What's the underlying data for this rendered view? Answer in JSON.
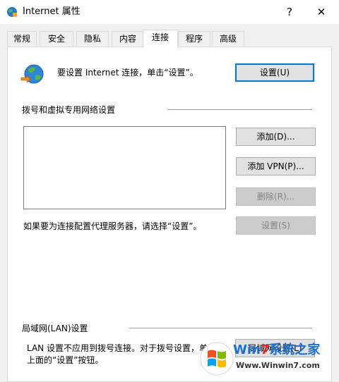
{
  "window": {
    "title": "Internet 属性",
    "help_label": "?",
    "close_label": "✕"
  },
  "tabs": [
    {
      "label": "常规",
      "active": false
    },
    {
      "label": "安全",
      "active": false
    },
    {
      "label": "隐私",
      "active": false
    },
    {
      "label": "内容",
      "active": false
    },
    {
      "label": "连接",
      "active": true
    },
    {
      "label": "程序",
      "active": false
    },
    {
      "label": "高级",
      "active": false
    }
  ],
  "connection": {
    "setup_text": "要设置 Internet 连接，单击“设置”。",
    "setup_button": "设置(U)",
    "setup_icon": "internet-globe-icon"
  },
  "dialup": {
    "heading": "拨号和虚拟专用网络设置",
    "add_button": "添加(D)...",
    "add_vpn_button": "添加 VPN(P)...",
    "remove_button": "删除(R)...",
    "proxy_text": "如果要为连接配置代理服务器，请选择“设置”。",
    "settings_button": "设置(S)"
  },
  "lan": {
    "heading": "局域网(LAN)设置",
    "note_line1": "LAN 设置不应用到拨号连接。对于拨号设置，单击",
    "note_line2": "上面的“设置”按钮。",
    "lan_button": "局域网设置(L)"
  },
  "watermark": {
    "brand_win": "Win",
    "brand_num": "7",
    "brand_rest": "系统之家",
    "url": "Www.Winwin7.com"
  },
  "colors": {
    "accent": "#0078d7",
    "panel_bg": "#ffffff",
    "window_bg": "#f0f0f0",
    "brand_blue": "#1a6fd1",
    "brand_red": "#e5252a"
  }
}
